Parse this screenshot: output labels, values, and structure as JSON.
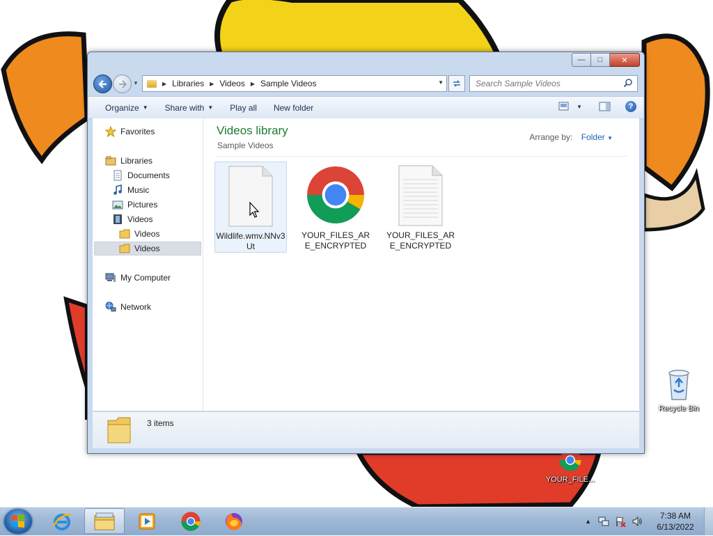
{
  "desktop": {
    "icons": [
      {
        "label": "Recycle Bin",
        "icon": "recycle-bin-icon"
      },
      {
        "label": "YOUR_FILE...",
        "icon": "chrome-icon"
      }
    ]
  },
  "window": {
    "controls": {
      "minimize": "—",
      "maximize": "□",
      "close": "✕"
    },
    "breadcrumb": [
      "Libraries",
      "Videos",
      "Sample Videos"
    ],
    "search": {
      "placeholder": "Search Sample Videos"
    },
    "toolbar": {
      "organize": "Organize",
      "share_with": "Share with",
      "play_all": "Play all",
      "new_folder": "New folder",
      "help": "?"
    },
    "nav": {
      "favorites": "Favorites",
      "libraries": "Libraries",
      "documents": "Documents",
      "music": "Music",
      "pictures": "Pictures",
      "videos": "Videos",
      "videos_sub1": "Videos",
      "videos_sub2": "Videos",
      "my_computer": "My Computer",
      "network": "Network"
    },
    "content": {
      "title": "Videos library",
      "subtitle": "Sample Videos",
      "arrange_label": "Arrange by:",
      "arrange_value": "Folder",
      "files": [
        {
          "name": "Wildlife.wmv.NNv3Ut",
          "icon": "blank-file-icon"
        },
        {
          "name": "YOUR_FILES_ARE_ENCRYPTED",
          "icon": "chrome-icon"
        },
        {
          "name": "YOUR_FILES_ARE_ENCRYPTED",
          "icon": "text-file-icon"
        }
      ]
    },
    "details": {
      "count": "3 items"
    }
  },
  "taskbar": {
    "apps": [
      "start-button",
      "internet-explorer",
      "windows-explorer",
      "media-player",
      "chrome",
      "firefox"
    ],
    "clock": {
      "time": "7:38 AM",
      "date": "6/13/2022"
    }
  },
  "colors": {
    "library_title": "#1e7b32",
    "link": "#1f5fb3",
    "accent": "#1d5aa5"
  }
}
